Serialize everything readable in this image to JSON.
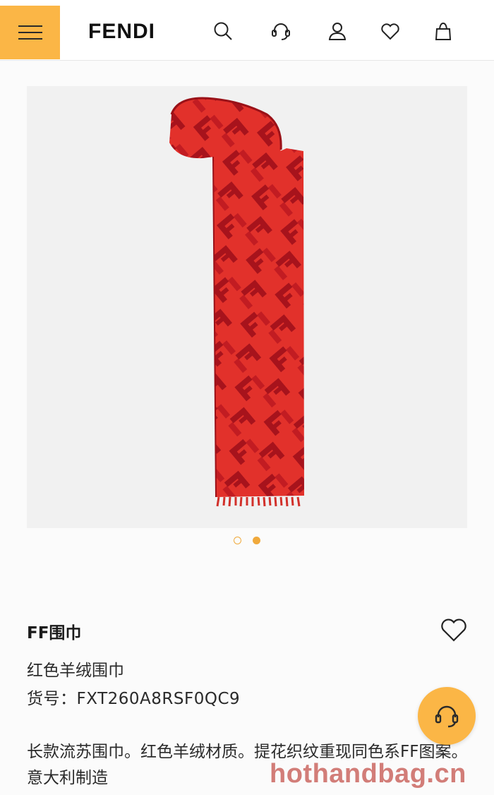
{
  "header": {
    "brand": "FENDI",
    "icons": [
      "menu-icon",
      "search-icon",
      "customer-service-icon",
      "account-icon",
      "wishlist-icon",
      "shopping-bag-icon"
    ]
  },
  "gallery": {
    "image_subject": "red-ff-scarf",
    "slide_count": 2,
    "active_slide": 2,
    "colors": {
      "scarf_light": "#e2312b",
      "scarf_dark": "#a7131c",
      "background": "#f1f1f1"
    }
  },
  "product": {
    "title": "FF围巾",
    "subtitle": "红色羊绒围巾",
    "code": "货号：FXT260A8RSF0QC9",
    "description": "长款流苏围巾。红色羊绒材质。提花织纹重现同色系FF图案。意大利制造"
  },
  "watermark": "hothandbag.cn",
  "colors": {
    "accent": "#fbb646",
    "dot_accent": "#f0a93c",
    "text": "#1f1f1f"
  }
}
